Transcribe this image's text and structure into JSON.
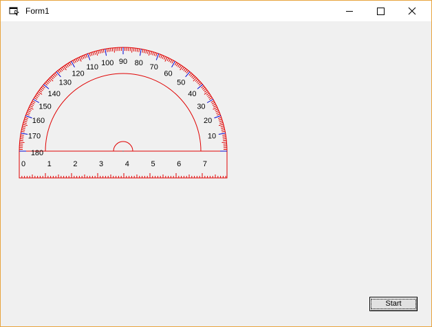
{
  "window": {
    "title": "Form1",
    "app_icon": "vb-form-icon",
    "caption_buttons": {
      "minimize_icon": "minimize-icon",
      "maximize_icon": "maximize-icon",
      "close_icon": "close-icon"
    }
  },
  "protractor": {
    "angle_labels": [
      "10",
      "20",
      "30",
      "40",
      "50",
      "60",
      "70",
      "80",
      "90",
      "100",
      "110",
      "120",
      "130",
      "140",
      "150",
      "160",
      "170",
      "180"
    ],
    "ruler_labels": [
      "0",
      "1",
      "2",
      "3",
      "4",
      "5",
      "6",
      "7"
    ],
    "colors": {
      "outline": "#e00000",
      "major_tick": "#0000cc",
      "minor_tick": "#e00000",
      "ruler": "#e00000"
    }
  },
  "start_button": {
    "label": "Start"
  },
  "colors": {
    "window_border": "#e8a33c",
    "client_bg": "#f0f0f0"
  }
}
